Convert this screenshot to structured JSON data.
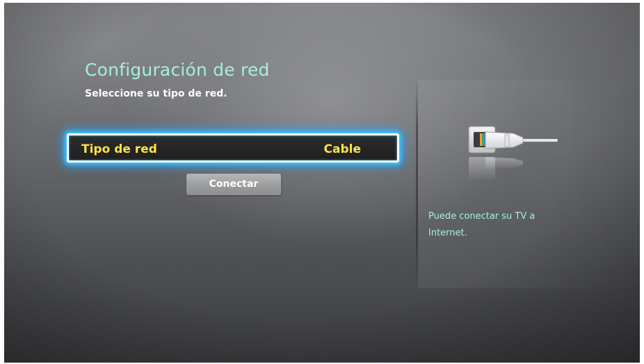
{
  "page": {
    "title": "Configuración de red",
    "subtitle": "Seleccione su tipo de red."
  },
  "network": {
    "label": "Tipo de red",
    "value": "Cable"
  },
  "connect_button": "Conectar",
  "help_text": "Puede conectar su TV a Internet.",
  "icons": {
    "cable": "ethernet-cable-icon"
  },
  "colors": {
    "title": "#a6f0d6",
    "highlight_text": "#ffe24a",
    "focus_glow": "#3fc6ff",
    "help_text": "#a6f0e0"
  }
}
